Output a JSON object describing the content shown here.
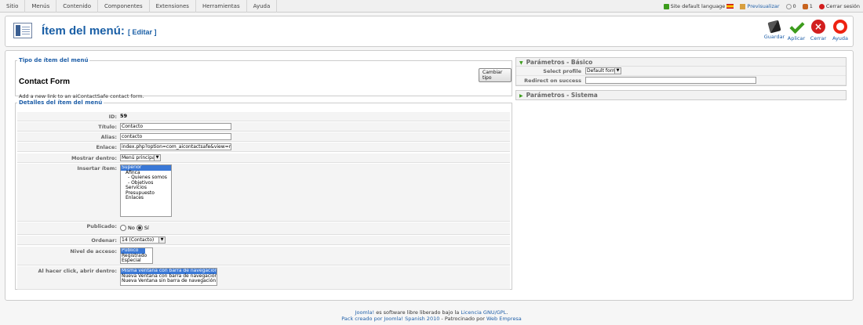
{
  "menu": {
    "items": [
      "Sitio",
      "Menús",
      "Contenido",
      "Componentes",
      "Extensiones",
      "Herramientas",
      "Ayuda"
    ]
  },
  "status": {
    "language_label": "Site default language",
    "preview_label": "Previsualizar",
    "messages_count": "0",
    "users_count": "1",
    "logout_label": "Cerrar sesión"
  },
  "header": {
    "title": "Ítem del menú:",
    "subtitle": "[ Editar ]"
  },
  "toolbar": {
    "save": "Guardar",
    "apply": "Aplicar",
    "close": "Cerrar",
    "help": "Ayuda"
  },
  "menu_type": {
    "legend": "Tipo de ítem del menú",
    "title": "Contact Form",
    "description": "Add a new link to an aiContactSafe contact form.",
    "change_button": "Cambiar tipo"
  },
  "details": {
    "legend": "Detalles del ítem del menú",
    "id_label": "ID:",
    "id_value": "59",
    "title_label": "Título:",
    "title_value": "Contacto",
    "alias_label": "Alias:",
    "alias_value": "contacto",
    "link_label": "Enlace:",
    "link_value": "index.php?option=com_aicontactsafe&view=message&",
    "show_in_label": "Mostrar dentro:",
    "show_in_value": "Menú principal",
    "parent_label": "Insertar ítem:",
    "parent_options": [
      "Superior",
      "Afinca",
      "- Quienes somos",
      "- Objetivos",
      "Servicios",
      "Presupuesto",
      "Enlaces"
    ],
    "published_label": "Publicado:",
    "published_no": "No",
    "published_yes": "Sí",
    "order_label": "Ordenar:",
    "order_value": "14 (Contacto)",
    "access_label": "Nivel de acceso:",
    "access_options": [
      "Público",
      "Registrado",
      "Especial"
    ],
    "onclick_label": "Al hacer click, abrir dentro:",
    "onclick_options": [
      "Misma ventana con barra de navegación",
      "Nueva Ventana con barra de navegación",
      "Nueva Ventana sin barra de navegación"
    ]
  },
  "params_basic": {
    "title": "Parámetros - Básico",
    "profile_label": "Select profile",
    "profile_value": "Default form",
    "redirect_label": "Redirect on success",
    "redirect_value": ""
  },
  "params_system": {
    "title": "Parámetros - Sistema"
  },
  "footer": {
    "line1_link": "Joomla!",
    "line1_text": " es software libre liberado bajo la ",
    "line1_license": "Licencia GNU/GPL",
    "line2_link": "Pack creado por Joomla! Spanish 2010",
    "line2_text": " - Patrocinado por ",
    "line2_sponsor": "Web Empresa"
  },
  "colors": {
    "link": "#1f5fa8",
    "selected": "#3a78d6",
    "accent_green": "#3c9c1c",
    "close_red": "#d21e1e"
  }
}
